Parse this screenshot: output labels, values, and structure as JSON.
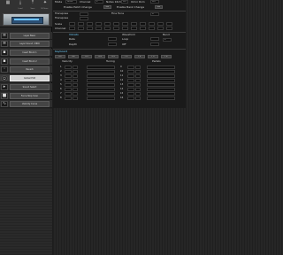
{
  "sidebar": {
    "header": {
      "icons": [
        {
          "icon": "grid-icon",
          "label": ""
        },
        {
          "icon": "download-icon",
          "label": "Load"
        },
        {
          "icon": "upload-icon",
          "label": "Save"
        },
        {
          "icon": "puzzle-icon",
          "label": "NI Store"
        }
      ]
    },
    "items": [
      {
        "label": "Layer Basic",
        "icon": "layer-icon"
      },
      {
        "label": "Layer Sound / MIDI",
        "icon": "layer-icon"
      },
      {
        "label": "Insert Block 1",
        "icon": "block-icon"
      },
      {
        "label": "Insert Block 2",
        "icon": "block-icon"
      },
      {
        "label": "Reverb",
        "icon": "reverb-icon"
      },
      {
        "label": "Global Edit",
        "icon": "power-icon",
        "active": true
      },
      {
        "label": "Sound Select",
        "icon": "select-icon"
      },
      {
        "label": "Force Stop Scan",
        "icon": "stop-icon"
      },
      {
        "label": "Velocity Curve",
        "icon": "curve-icon"
      }
    ]
  },
  "main": {
    "top": {
      "mode_label": "Mode",
      "mode_value": "Multi",
      "channel_label": "Channel",
      "channel_value": "1",
      "notes_label": "Notes 16ch",
      "notes_value": "Off",
      "omni_label": "Omni Rom",
      "omni_value": "Off",
      "enable_patch": "Enable Patch Change",
      "enable_patch_val": "Off",
      "enable_bank": "Enable Bank Change",
      "enable_bank_val": "Off"
    },
    "params": {
      "rows": [
        "Transpose",
        "Transpose",
        "Scale",
        "Channel"
      ],
      "fine_tune_label": "Fine Tune",
      "fine_tune_value": "0"
    },
    "mid": {
      "left_title": "Vibrato",
      "left_rows": [
        "Rate",
        "Depth"
      ],
      "right_title": "Waveform",
      "right_rows": [
        "Loop",
        "Off"
      ],
      "bend_label": "Bend",
      "bend_value": "2"
    },
    "split": {
      "title": "Keyboard",
      "top_labels": [
        "C1",
        "C2",
        "C3",
        "C4",
        "C5",
        "F1",
        "F2",
        "F3",
        "F4"
      ],
      "col1": "Velocity",
      "col2": "Tuning",
      "col3": "Pedals",
      "rows_left": [
        "1",
        "2",
        "3",
        "4",
        "5",
        "6",
        "7",
        "8"
      ],
      "rows_right": [
        "9",
        "10",
        "11",
        "12",
        "13",
        "14",
        "15",
        "16"
      ]
    }
  }
}
